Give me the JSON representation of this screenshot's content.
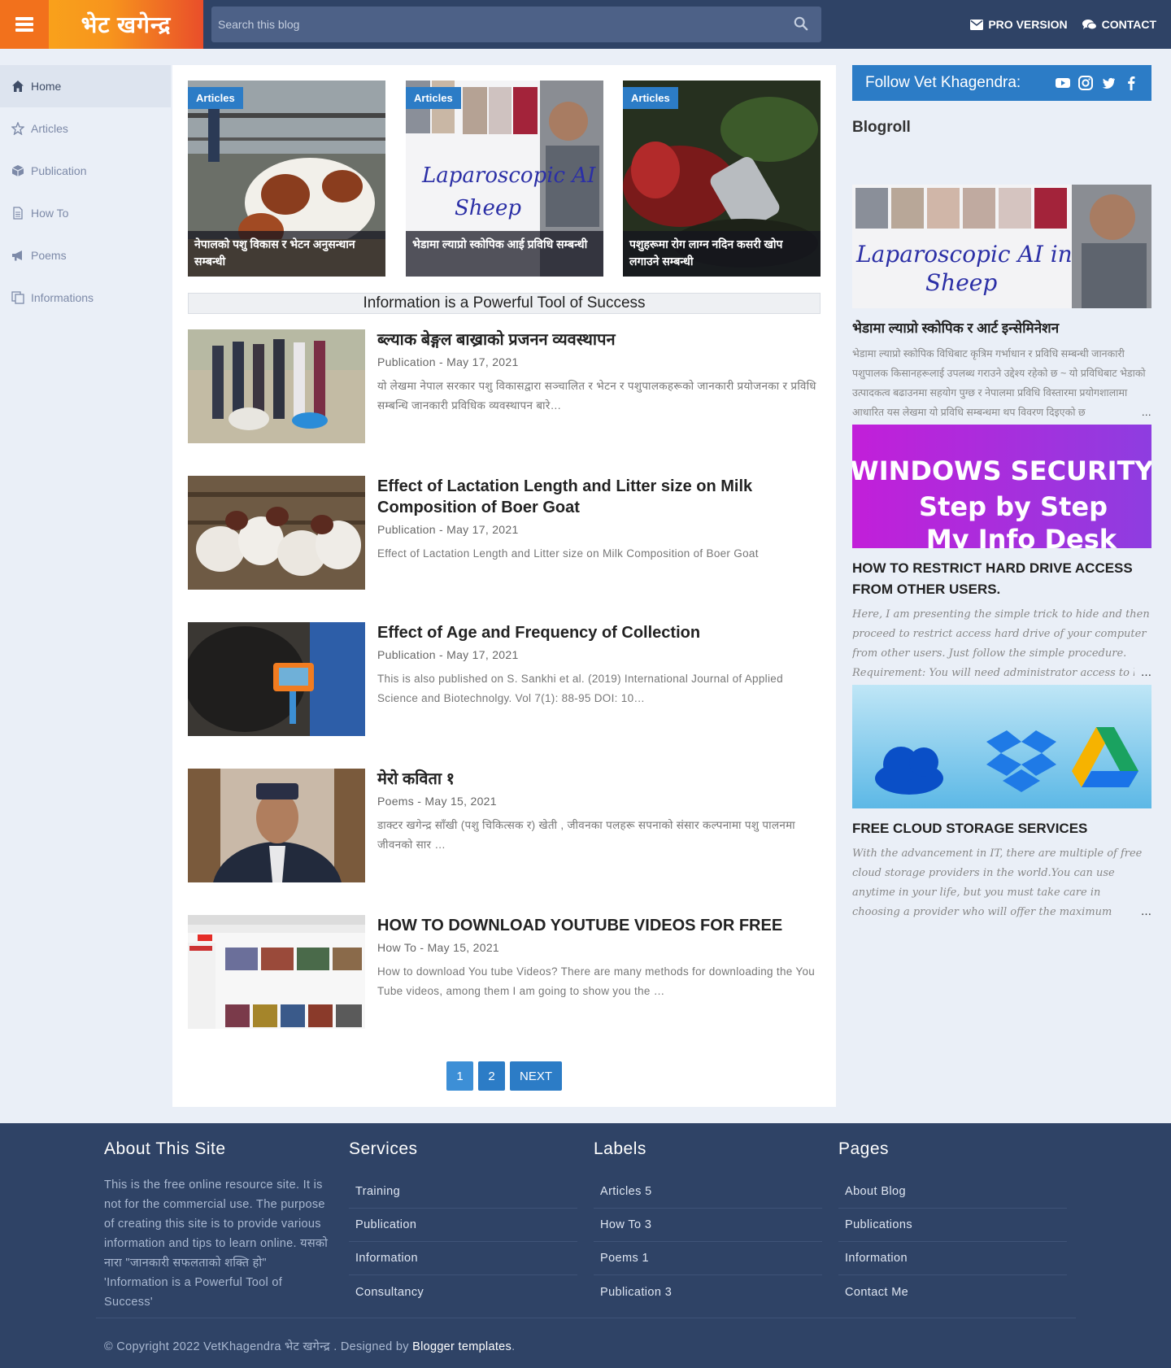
{
  "header": {
    "logo": "भेट खगेन्द्र",
    "search_placeholder": "Search this blog",
    "pro_label": "PRO VERSION",
    "contact_label": "CONTACT"
  },
  "sidebar": {
    "items": [
      {
        "label": "Home",
        "icon": "home-icon"
      },
      {
        "label": "Articles",
        "icon": "star-icon"
      },
      {
        "label": "Publication",
        "icon": "cube-icon"
      },
      {
        "label": "How To",
        "icon": "document-icon"
      },
      {
        "label": "Poems",
        "icon": "bullhorn-icon"
      },
      {
        "label": "Informations",
        "icon": "copy-icon"
      }
    ]
  },
  "featured": [
    {
      "tag": "Articles",
      "caption": "नेपालको पशु विकास र भेटन अनुसन्धान सम्बन्धी"
    },
    {
      "tag": "Articles",
      "caption": "भेडामा ल्याप्रो स्कोपिक आई प्रविधि सम्बन्धी"
    },
    {
      "tag": "Articles",
      "caption": "पशुहरूमा रोग लाग्न नदिन कसरी खोप लगाउने सम्बन्धी"
    }
  ],
  "tagline": "Information is a Powerful Tool of Success",
  "posts": [
    {
      "title": "ब्ल्याक बेङ्गल बाख्राको प्रजनन व्यवस्थापन",
      "meta": "Publication - May 17, 2021",
      "excerpt": "यो लेखमा नेपाल सरकार पशु विकासद्वारा सञ्चालित र भेटन र पशुपालकहरूको जानकारी प्रयोजनका र प्रविधि सम्बन्धि जानकारी प्रविधिक व्यवस्थापन बारे…"
    },
    {
      "title": "Effect of Lactation Length and Litter size on Milk Composition of Boer Goat",
      "meta": "Publication - May 17, 2021",
      "excerpt": "Effect of Lactation Length and Litter size on Milk Composition of Boer Goat"
    },
    {
      "title": "Effect of Age and Frequency of Collection",
      "meta": "Publication - May 17, 2021",
      "excerpt": "This is also published on  S. Sankhi et al. (2019) International Journal of  Applied Science and Biotechnolgy. Vol 7(1): 88-95 DOI: 10…"
    },
    {
      "title": "मेरो कविता १",
      "meta": "Poems - May 15, 2021",
      "excerpt": "डाक्टर खगेन्द्र साँखी (पशु चिकित्सक र) खेती ,      जीवनका पलहरू        सपनाको संसार कल्पनामा पशु पालनमा जीवनको सार …"
    },
    {
      "title": "HOW TO DOWNLOAD YOUTUBE VIDEOS FOR FREE",
      "meta": "How To - May 15, 2021",
      "excerpt": "How to download You tube Videos? There are many methods for downloading the You Tube videos, among them I am going to show you the …"
    }
  ],
  "pager": {
    "p1": "1",
    "p2": "2",
    "next": "NEXT"
  },
  "right": {
    "follow_title": "Follow Vet Khagendra:",
    "blogroll_title": "Blogroll",
    "posts": [
      {
        "title": "भेडामा ल्याप्रो स्कोपिक र आर्ट इन्सेमिनेशन",
        "snippet": "भेडामा ल्याप्रो स्कोपिक विधिबाट कृत्रिम गर्भाधान र प्रविधि सम्बन्धी जानकारी पशुपालक किसानहरूलाई उपलब्ध गराउने उद्देश्य रहेको छ ~ यो प्रविधिबाट भेडाको उत्पादकत्व बढाउनमा सहयोग पुग्छ र नेपालमा प्रविधि विस्तारमा प्रयोगशालामा आधारित यस लेखमा यो प्रविधि सम्बन्धमा थप विवरण दिइएको छ"
      },
      {
        "title": "HOW TO RESTRICT HARD DRIVE ACCESS FROM OTHER USERS.",
        "snippet": "Here, I am presenting the simple trick to hide and then proceed to restrict access hard drive of your computer from other users. Just follow the simple procedure. Requirement:  You will need administrator access to be able to carry out"
      },
      {
        "title": "FREE CLOUD STORAGE SERVICES",
        "snippet": "With the advancement in IT, there are multiple of free cloud storage providers in the world.You can use anytime in your life, but you must take care in choosing a provider who will offer the maximum amount of free storage, while still"
      }
    ],
    "more": "…",
    "win_security_line1": "WINDOWS SECURITY",
    "win_security_line2": "Step by Step",
    "win_security_line3": "My Info Desk"
  },
  "footer": {
    "about_title": "About This Site",
    "about_text": "This is the free online resource site. It is not for the commercial use. The purpose of creating this site is to provide various information and tips to learn online. यसको नारा \"जानकारी सफलताको शक्ति हो\" 'Information is a Powerful Tool of Success'",
    "services_title": "Services",
    "services": [
      "Training",
      "Publication",
      "Information",
      "Consultancy"
    ],
    "labels_title": "Labels",
    "labels": [
      "Articles 5",
      "How To 3",
      "Poems 1",
      "Publication 3"
    ],
    "pages_title": "Pages",
    "pages": [
      "About Blog",
      "Publications",
      "Information",
      "Contact Me"
    ],
    "copyright_prefix": "© Copyright 2022 VetKhagendra भेट खगेन्द्र . Designed by ",
    "copyright_link": "Blogger templates",
    "copyright_suffix": "."
  },
  "colors": {
    "header_bg": "#2f4366",
    "accent_blue": "#2c7cc6",
    "menu_orange": "#f2711c",
    "page_bg": "#eaeff7"
  }
}
